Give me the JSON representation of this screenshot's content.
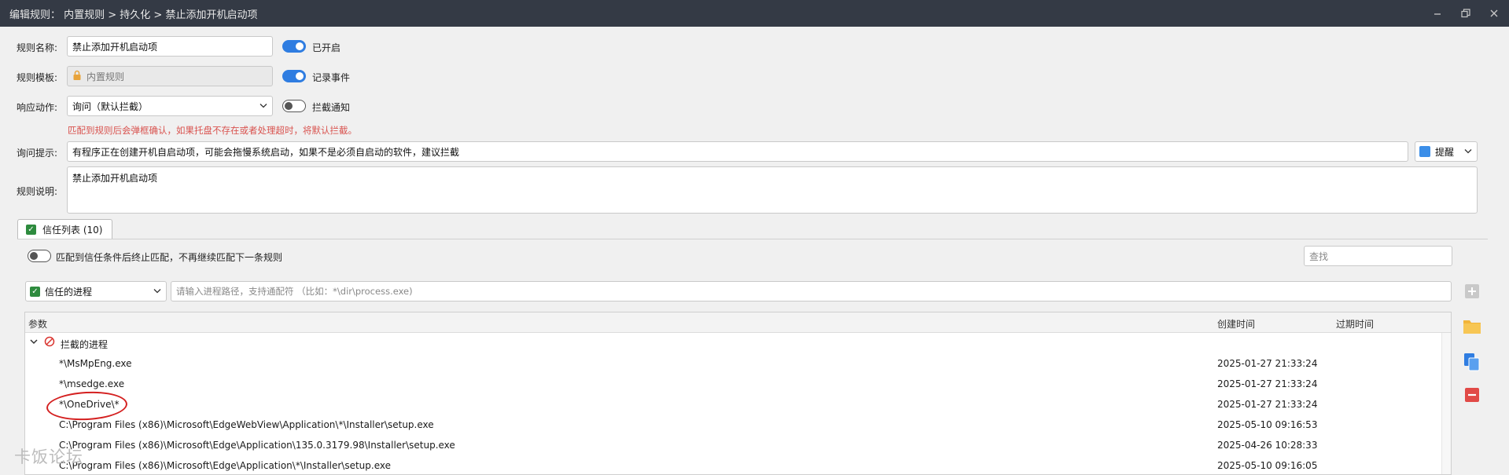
{
  "window": {
    "title": "编辑规则：  内置规则 > 持久化 > 禁止添加开机启动项",
    "minimize_icon": "minimize-icon",
    "restore_icon": "restore-icon",
    "close_icon": "close-icon"
  },
  "form": {
    "rule_name_label": "规则名称:",
    "rule_name_value": "禁止添加开机启动项",
    "enabled_label": "已开启",
    "enabled": true,
    "template_label": "规则模板:",
    "template_value": "内置规则",
    "log_label": "记录事件",
    "log_enabled": true,
    "action_label": "响应动作:",
    "action_value": "询问（默认拦截）",
    "notify_label": "拦截通知",
    "notify_enabled": false,
    "warning": "匹配到规则后会弹框确认，如果托盘不存在或者处理超时，将默认拦截。",
    "prompt_label": "询问提示:",
    "prompt_value": "有程序正在创建开机自启动项，可能会拖慢系统启动，如果不是必须自启动的软件，建议拦截",
    "level_value": "提醒",
    "level_color": "#3b8ee8",
    "desc_label": "规则说明:",
    "desc_value": "禁止添加开机启动项"
  },
  "tab": {
    "label": "信任列表 (10)"
  },
  "trust": {
    "stop_match_label": "匹配到信任条件后终止匹配，不再继续匹配下一条规则",
    "stop_match_enabled": false,
    "search_placeholder": "查找",
    "type_value": "信任的进程",
    "path_placeholder": "请输入进程路径，支持通配符 （比如：*\\dir\\process.exe)"
  },
  "table": {
    "columns": [
      "参数",
      "创建时间",
      "过期时间"
    ],
    "group_label": "拦截的进程",
    "rows": [
      {
        "param": "*\\MsMpEng.exe",
        "created": "2025-01-27 21:33:24",
        "expire": ""
      },
      {
        "param": "*\\msedge.exe",
        "created": "2025-01-27 21:33:24",
        "expire": ""
      },
      {
        "param": "*\\OneDrive\\*",
        "created": "2025-01-27 21:33:24",
        "expire": ""
      },
      {
        "param": "C:\\Program Files (x86)\\Microsoft\\EdgeWebView\\Application\\*\\Installer\\setup.exe",
        "created": "2025-05-10 09:16:53",
        "expire": ""
      },
      {
        "param": "C:\\Program Files (x86)\\Microsoft\\Edge\\Application\\135.0.3179.98\\Installer\\setup.exe",
        "created": "2025-04-26 10:28:33",
        "expire": ""
      },
      {
        "param": "C:\\Program Files (x86)\\Microsoft\\Edge\\Application\\*\\Installer\\setup.exe",
        "created": "2025-05-10 09:16:05",
        "expire": ""
      }
    ]
  },
  "watermark": "卡饭论坛"
}
